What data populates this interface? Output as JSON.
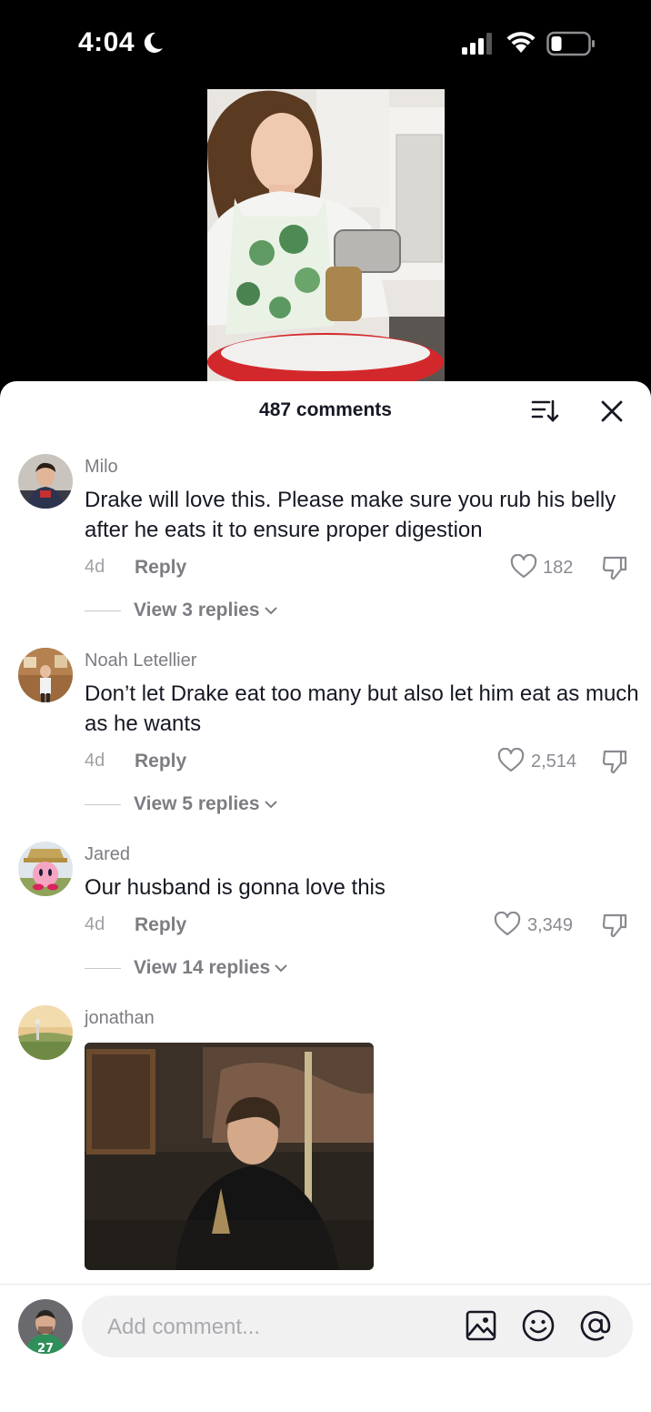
{
  "status_bar": {
    "time": "4:04"
  },
  "sheet": {
    "title": "487 comments"
  },
  "comments": [
    {
      "username": "Milo",
      "text": "Drake will love this. Please make sure you rub his belly after he eats it to ensure proper digestion",
      "age": "4d",
      "reply_label": "Reply",
      "likes": "182",
      "view_replies": "View 3 replies"
    },
    {
      "username": "Noah Letellier",
      "text": "Don’t let Drake eat too many but also let him eat as much as he wants",
      "age": "4d",
      "reply_label": "Reply",
      "likes": "2,514",
      "view_replies": "View 5 replies"
    },
    {
      "username": "Jared",
      "text": "Our husband is gonna love this",
      "age": "4d",
      "reply_label": "Reply",
      "likes": "3,349",
      "view_replies": "View 14 replies"
    },
    {
      "username": "jonathan"
    }
  ],
  "composer": {
    "placeholder": "Add comment..."
  },
  "colors": {
    "text_primary": "#161823",
    "text_secondary": "#7c7d82",
    "sheet_bg": "#ffffff",
    "input_bg": "#f1f1f2"
  }
}
